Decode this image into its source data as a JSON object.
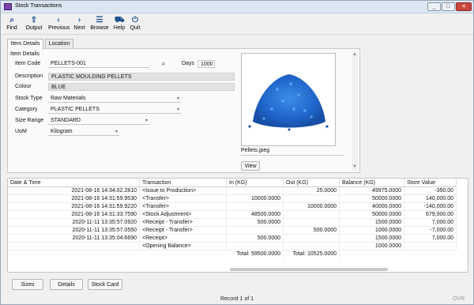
{
  "window": {
    "title": "Stock Transactions",
    "min_label": "_",
    "max_label": "□",
    "close_label": "✕"
  },
  "toolbar": [
    {
      "name": "find",
      "label": "Find",
      "icon": "search-icon",
      "glyph": "⌕"
    },
    {
      "name": "output",
      "label": "Output",
      "icon": "upload-icon",
      "glyph": "⇪"
    },
    {
      "name": "previous",
      "label": "Previous",
      "icon": "chevron-left-icon",
      "glyph": "‹"
    },
    {
      "name": "next",
      "label": "Next",
      "icon": "chevron-right-icon",
      "glyph": "›"
    },
    {
      "name": "browse",
      "label": "Browse",
      "icon": "list-icon",
      "glyph": "☰"
    },
    {
      "name": "help",
      "label": "Help",
      "icon": "help-icon",
      "glyph": "⛟"
    },
    {
      "name": "quit",
      "label": "Quit",
      "icon": "power-icon",
      "glyph": "⏻"
    }
  ],
  "tabs": {
    "item_details": "Item Details",
    "location": "Location"
  },
  "form": {
    "group_label": "Item Details",
    "item_code_label": "Item Code",
    "item_code": "PELLETS-001",
    "days_label": "Days",
    "days": "1000",
    "description_label": "Description",
    "description": "PLASTIC MOULDING PELLETS",
    "colour_label": "Colour",
    "colour": "BLUE",
    "stock_type_label": "Stock Type",
    "stock_type": "Raw Materials",
    "category_label": "Category",
    "category": "PLASTIC PELLETS",
    "size_range_label": "Size Range",
    "size_range": "STANDARD",
    "uom_label": "UoM",
    "uom": "Kilogram"
  },
  "image": {
    "caption": "Pellets.jpeg",
    "view_label": "View"
  },
  "grid": {
    "headers": [
      "Date & Time",
      "Transaction",
      "In (KG)",
      "Out (KG)",
      "Balance (KG)",
      "Store Value"
    ],
    "rows": [
      [
        "2021-08-16 14:34:02.2810",
        "<Issue to Production>",
        "",
        "25.0000",
        "49975.0000",
        "-350.00"
      ],
      [
        "2021-08-16 14:31:59.9530",
        "<Transfer>",
        "10000.0000",
        "",
        "50000.0000",
        "140,000.00"
      ],
      [
        "2021-08-16 14:31:59.9220",
        "<Transfer>",
        "",
        "10000.0000",
        "40000.0000",
        "-140,000.00"
      ],
      [
        "2021-08-16 14:31:33.7590",
        "<Stock Adjustment>",
        "48500.0000",
        "",
        "50000.0000",
        "679,000.00"
      ],
      [
        "2020-11-11 13:35:57.0920",
        "<Receipt - Transfer>",
        "500.0000",
        "",
        "1500.0000",
        "7,000.00"
      ],
      [
        "2020-11-11 13:35:57.0550",
        "<Receipt - Transfer>",
        "",
        "500.0000",
        "1000.0000",
        "-7,000.00"
      ],
      [
        "2020-11-11 13:35:04.6690",
        "<Receipt>",
        "500.0000",
        "",
        "1500.0000",
        "7,000.00"
      ],
      [
        "",
        "<Opening Balance>",
        "",
        "",
        "1000.0000",
        ""
      ]
    ],
    "total_in_label": "Total:",
    "total_in": "59500.0000",
    "total_out_label": "Total:",
    "total_out": "10525.0000"
  },
  "buttons": {
    "sizes": "Sizes",
    "details": "Details",
    "stock_card": "Stock Card"
  },
  "status": {
    "record": "Record 1 of 1",
    "ovr": "OVR"
  }
}
